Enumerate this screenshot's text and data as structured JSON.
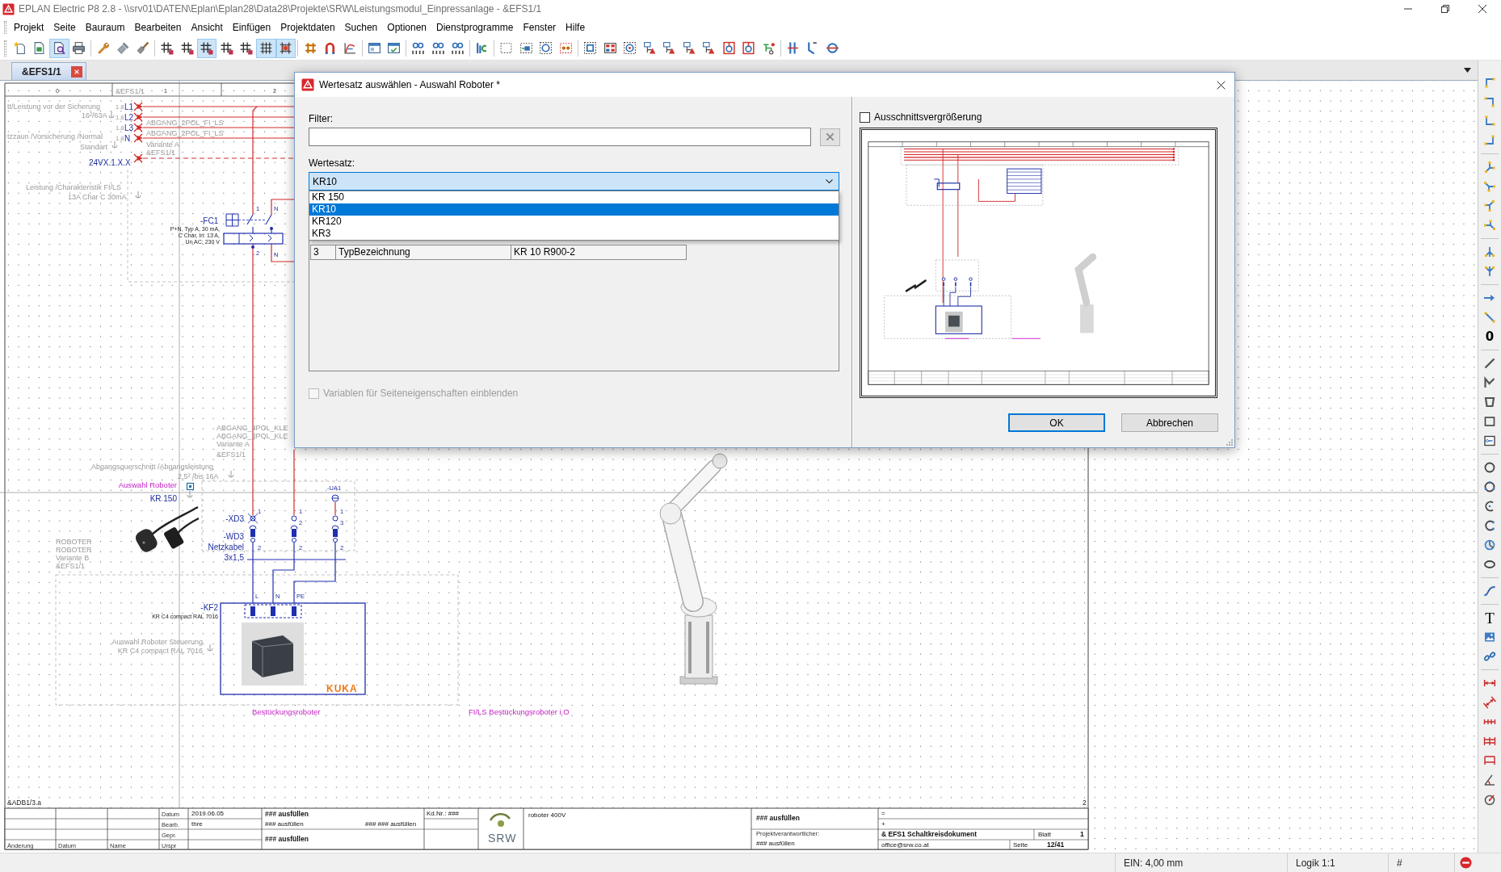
{
  "window": {
    "title": "EPLAN Electric P8 2.8 - \\\\srv01\\DATEN\\Eplan\\Eplan28\\Data28\\Projekte\\SRW\\Leistungsmodul_Einpressanlage - &EFS1/1"
  },
  "menu": [
    "Projekt",
    "Seite",
    "Bauraum",
    "Bearbeiten",
    "Ansicht",
    "Einfügen",
    "Projektdaten",
    "Suchen",
    "Optionen",
    "Dienstprogramme",
    "Fenster",
    "Hilfe"
  ],
  "toolbar": [
    [
      {
        "kind": "page-star",
        "on": false
      },
      {
        "kind": "page-green",
        "on": false
      },
      {
        "kind": "page-lens",
        "on": true
      },
      {
        "kind": "printer",
        "on": false
      }
    ],
    [
      {
        "kind": "wrench",
        "on": false
      },
      {
        "kind": "stamp",
        "on": false
      },
      {
        "kind": "brush",
        "on": false
      }
    ],
    [
      {
        "kind": "grid-mark",
        "on": false
      },
      {
        "kind": "grid-mark",
        "on": false
      },
      {
        "kind": "grid-mark",
        "on": true
      },
      {
        "kind": "grid-mark",
        "on": false
      },
      {
        "kind": "grid-mark",
        "on": false
      },
      {
        "kind": "grid",
        "on": true
      },
      {
        "kind": "snap",
        "on": true
      }
    ],
    [
      {
        "kind": "hash",
        "on": false
      },
      {
        "kind": "magnet",
        "on": false
      },
      {
        "kind": "curve",
        "on": false
      }
    ],
    [
      {
        "kind": "window",
        "on": false
      },
      {
        "kind": "window-tick",
        "on": false
      }
    ],
    [
      {
        "kind": "counter",
        "on": false
      },
      {
        "kind": "counter",
        "on": false
      },
      {
        "kind": "counter",
        "on": false
      }
    ],
    [
      {
        "kind": "bar-chart",
        "on": false
      }
    ],
    [
      {
        "kind": "dashed-rect",
        "on": false
      },
      {
        "kind": "rect-arrow",
        "on": false
      },
      {
        "kind": "circle-dots",
        "on": false
      },
      {
        "kind": "dots-rect",
        "on": false
      }
    ],
    [
      {
        "kind": "device-square",
        "on": false
      },
      {
        "kind": "device-grid",
        "on": false
      },
      {
        "kind": "device-target",
        "on": false
      },
      {
        "kind": "device-tree",
        "on": false
      },
      {
        "kind": "device-tree",
        "on": false
      },
      {
        "kind": "device-tree",
        "on": false
      },
      {
        "kind": "device-tree",
        "on": false
      },
      {
        "kind": "device-ring",
        "on": false
      },
      {
        "kind": "device-ring",
        "on": false
      },
      {
        "kind": "device-green",
        "on": false
      }
    ],
    [
      {
        "kind": "double-bar",
        "on": false
      },
      {
        "kind": "corner-arrow",
        "on": false
      },
      {
        "kind": "circle-line",
        "on": false
      }
    ]
  ],
  "tabs": [
    {
      "label": "&EFS1/1",
      "selected": true
    }
  ],
  "schematic": {
    "labels": [
      {
        "kind": "column",
        "text": "0"
      },
      {
        "kind": "property",
        "text": "&EFS1/1"
      },
      {
        "kind": "column",
        "text": "1"
      },
      {
        "kind": "column",
        "text": "2"
      },
      {
        "kind": "property",
        "text": "tt/Leistung vor der Sicherung"
      },
      {
        "kind": "note",
        "text": "1.8"
      },
      {
        "kind": "potential",
        "text": "L1"
      },
      {
        "kind": "property",
        "text": "16²/63A"
      },
      {
        "kind": "note",
        "text": "1.8"
      },
      {
        "kind": "potential",
        "text": "L2"
      },
      {
        "kind": "property",
        "text": "ABGANG_2POL_FI_LS"
      },
      {
        "kind": "note",
        "text": "1.8"
      },
      {
        "kind": "potential",
        "text": "L3"
      },
      {
        "kind": "property",
        "text": "tzzaun /Vorsicherung /Normal"
      },
      {
        "kind": "note",
        "text": "1.8"
      },
      {
        "kind": "potential",
        "text": "N"
      },
      {
        "kind": "property",
        "text": "ABGANG_2POL_FI_LS"
      },
      {
        "kind": "property",
        "text": "Standart"
      },
      {
        "kind": "property",
        "text": "Variante A"
      },
      {
        "kind": "property",
        "text": "&EFS1/1"
      },
      {
        "kind": "potential",
        "text": "24VX.1.X.X"
      },
      {
        "kind": "property",
        "text": "Leistung /Charakteristik FI/LS"
      },
      {
        "kind": "property",
        "text": "13A Char C 30mA"
      },
      {
        "kind": "tag",
        "text": "-FC1"
      },
      {
        "kind": "spec",
        "text": "P+N, Typ A, 30 mA,"
      },
      {
        "kind": "spec",
        "text": "C Char, In: 13 A,"
      },
      {
        "kind": "spec",
        "text": "Un AC: 230 V"
      },
      {
        "kind": "pin",
        "text": "1"
      },
      {
        "kind": "pin",
        "text": "N"
      },
      {
        "kind": "pin",
        "text": "2"
      },
      {
        "kind": "pin",
        "text": "N"
      },
      {
        "kind": "property",
        "text": "ABGANG_3POL_KLE"
      },
      {
        "kind": "property",
        "text": "ABGANG_3POL_KLE"
      },
      {
        "kind": "property",
        "text": "Variante A"
      },
      {
        "kind": "property",
        "text": "&EFS1/1"
      },
      {
        "kind": "property",
        "text": "Abgangsquerschnitt /Abgangsleistung"
      },
      {
        "kind": "property",
        "text": "2,5² /bis 16A"
      },
      {
        "kind": "function",
        "text": "Auswahl Roboter"
      },
      {
        "kind": "tag",
        "text": "KR 150"
      },
      {
        "kind": "smalltag",
        "text": "-UA1"
      },
      {
        "kind": "pin",
        "text": "1"
      },
      {
        "kind": "pin",
        "text": "1"
      },
      {
        "kind": "pin",
        "text": "1"
      },
      {
        "kind": "tag",
        "text": "-XD3"
      },
      {
        "kind": "pin",
        "text": "2"
      },
      {
        "kind": "pin",
        "text": "3"
      },
      {
        "kind": "tag",
        "text": "-WD3"
      },
      {
        "kind": "tag",
        "text": "Netzkabel"
      },
      {
        "kind": "pin",
        "text": "2"
      },
      {
        "kind": "pin",
        "text": "2"
      },
      {
        "kind": "pin",
        "text": "2"
      },
      {
        "kind": "tag",
        "text": "3x1,5"
      },
      {
        "kind": "property",
        "text": "ROBOTER"
      },
      {
        "kind": "property",
        "text": "ROBOTER"
      },
      {
        "kind": "property",
        "text": "Variante B"
      },
      {
        "kind": "property",
        "text": "&EFS1/1"
      },
      {
        "kind": "pin",
        "text": "L"
      },
      {
        "kind": "pin",
        "text": "N"
      },
      {
        "kind": "pin",
        "text": "PE"
      },
      {
        "kind": "tag",
        "text": "-KF2"
      },
      {
        "kind": "spec",
        "text": "KR C4 compact RAL 7016"
      },
      {
        "kind": "property",
        "text": "Auswahl Roboter Steuerung"
      },
      {
        "kind": "property",
        "text": "KR C4 compact RAL 7016"
      },
      {
        "kind": "brand",
        "text": "KUKA"
      },
      {
        "kind": "function",
        "text": "Bestückungsroboter"
      },
      {
        "kind": "function",
        "text": "FI/LS Bestückungsroboter i.O"
      },
      {
        "kind": "sheet",
        "text": "&ADB1/3.a"
      },
      {
        "kind": "sheet",
        "text": "2"
      }
    ]
  },
  "title_block": {
    "logo": "SRW",
    "fields": [
      {
        "kind": "caption",
        "text": "Datum"
      },
      {
        "kind": "value",
        "text": "2019.06.05"
      },
      {
        "kind": "strong",
        "text": "### ausfüllen"
      },
      {
        "kind": "value",
        "text": "Kd.Nr.: ###"
      },
      {
        "kind": "value",
        "text": "roboter 400V"
      },
      {
        "kind": "strong",
        "text": "### ausfüllen"
      },
      {
        "kind": "value",
        "text": "="
      },
      {
        "kind": "caption",
        "text": "Bearb."
      },
      {
        "kind": "value",
        "text": "thre"
      },
      {
        "kind": "value",
        "text": "### ausfüllen"
      },
      {
        "kind": "value",
        "text": "### ### ausfüllen"
      },
      {
        "kind": "value",
        "text": "+"
      },
      {
        "kind": "caption",
        "text": "Gepr."
      },
      {
        "kind": "caption",
        "text": "Projektverantwortlicher:"
      },
      {
        "kind": "strong",
        "text": "& EFS1 Schaltkreisdokument"
      },
      {
        "kind": "value",
        "text": "Blatt"
      },
      {
        "kind": "strong",
        "text": "1"
      },
      {
        "kind": "strong",
        "text": "### ausfüllen"
      },
      {
        "kind": "value",
        "text": "### ausfüllen"
      },
      {
        "kind": "caption",
        "text": "Änderung"
      },
      {
        "kind": "caption",
        "text": "Datum"
      },
      {
        "kind": "caption",
        "text": "Name"
      },
      {
        "kind": "caption",
        "text": "Urspr"
      },
      {
        "kind": "value",
        "text": "office@srw.co.at"
      },
      {
        "kind": "value",
        "text": "Seite"
      },
      {
        "kind": "strong",
        "text": "12/41"
      }
    ]
  },
  "side_toolbar": [
    [
      {
        "kind": "corner-a"
      },
      {
        "kind": "corner-b"
      },
      {
        "kind": "corner-c"
      },
      {
        "kind": "corner-d"
      }
    ],
    [
      {
        "kind": "tee-a"
      },
      {
        "kind": "tee-b"
      },
      {
        "kind": "tee-c"
      },
      {
        "kind": "tee-d"
      }
    ],
    [
      {
        "kind": "branch-a"
      },
      {
        "kind": "branch-b"
      }
    ],
    [
      {
        "kind": "arrow"
      },
      {
        "kind": "diagonal"
      },
      {
        "kind": "digit",
        "label": "0"
      }
    ],
    [
      {
        "kind": "line"
      },
      {
        "kind": "polyline"
      },
      {
        "kind": "polygon"
      },
      {
        "kind": "rectangle"
      },
      {
        "kind": "frame"
      }
    ],
    [
      {
        "kind": "circle"
      },
      {
        "kind": "circle-points"
      },
      {
        "kind": "arc"
      },
      {
        "kind": "arc-b"
      },
      {
        "kind": "pie"
      },
      {
        "kind": "ellipse"
      }
    ],
    [
      {
        "kind": "spline"
      }
    ],
    [
      {
        "kind": "letter",
        "label": "T"
      },
      {
        "kind": "image"
      },
      {
        "kind": "link"
      }
    ],
    [
      {
        "kind": "dim-h"
      },
      {
        "kind": "dim-diag"
      },
      {
        "kind": "dim-chain"
      },
      {
        "kind": "dim-base"
      },
      {
        "kind": "dim-frame"
      },
      {
        "kind": "angle"
      },
      {
        "kind": "radius"
      }
    ]
  ],
  "status_bar": {
    "fields": [
      "EIN: 4,00 mm",
      "Logik 1:1",
      "#"
    ]
  },
  "dialog": {
    "title": "Wertesatz auswählen - Auswahl Roboter *",
    "filter": {
      "label": "Filter:"
    },
    "value_set": {
      "label": "Wertesatz:",
      "value": "KR10",
      "expanded": true,
      "options": [
        {
          "label": "KR 150",
          "selected": false
        },
        {
          "label": "KR10",
          "selected": true
        },
        {
          "label": "KR120",
          "selected": false
        },
        {
          "label": "KR3",
          "selected": false
        }
      ]
    },
    "table": {
      "rows": [
        [
          "3",
          "TypBezeichnung",
          "KR 10 R900-2"
        ]
      ]
    },
    "show_page_variables": {
      "label": "Variablen für Seiteneigenschaften einblenden",
      "checked": false,
      "disabled": true
    },
    "zoom_detail": {
      "label": "Ausschnittsvergrößerung",
      "checked": false
    },
    "buttons": [
      {
        "label": "OK",
        "default": true
      },
      {
        "label": "Abbrechen",
        "default": false
      }
    ]
  }
}
